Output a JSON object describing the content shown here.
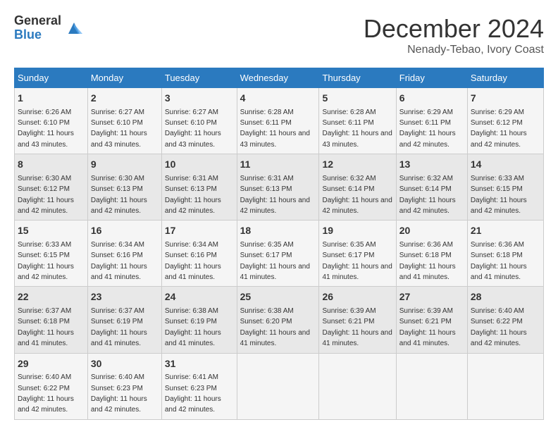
{
  "logo": {
    "general": "General",
    "blue": "Blue"
  },
  "title": {
    "month": "December 2024",
    "location": "Nenady-Tebao, Ivory Coast"
  },
  "days_of_week": [
    "Sunday",
    "Monday",
    "Tuesday",
    "Wednesday",
    "Thursday",
    "Friday",
    "Saturday"
  ],
  "weeks": [
    [
      {
        "day": "1",
        "info": "Sunrise: 6:26 AM\nSunset: 6:10 PM\nDaylight: 11 hours and 43 minutes."
      },
      {
        "day": "2",
        "info": "Sunrise: 6:27 AM\nSunset: 6:10 PM\nDaylight: 11 hours and 43 minutes."
      },
      {
        "day": "3",
        "info": "Sunrise: 6:27 AM\nSunset: 6:10 PM\nDaylight: 11 hours and 43 minutes."
      },
      {
        "day": "4",
        "info": "Sunrise: 6:28 AM\nSunset: 6:11 PM\nDaylight: 11 hours and 43 minutes."
      },
      {
        "day": "5",
        "info": "Sunrise: 6:28 AM\nSunset: 6:11 PM\nDaylight: 11 hours and 43 minutes."
      },
      {
        "day": "6",
        "info": "Sunrise: 6:29 AM\nSunset: 6:11 PM\nDaylight: 11 hours and 42 minutes."
      },
      {
        "day": "7",
        "info": "Sunrise: 6:29 AM\nSunset: 6:12 PM\nDaylight: 11 hours and 42 minutes."
      }
    ],
    [
      {
        "day": "8",
        "info": "Sunrise: 6:30 AM\nSunset: 6:12 PM\nDaylight: 11 hours and 42 minutes."
      },
      {
        "day": "9",
        "info": "Sunrise: 6:30 AM\nSunset: 6:13 PM\nDaylight: 11 hours and 42 minutes."
      },
      {
        "day": "10",
        "info": "Sunrise: 6:31 AM\nSunset: 6:13 PM\nDaylight: 11 hours and 42 minutes."
      },
      {
        "day": "11",
        "info": "Sunrise: 6:31 AM\nSunset: 6:13 PM\nDaylight: 11 hours and 42 minutes."
      },
      {
        "day": "12",
        "info": "Sunrise: 6:32 AM\nSunset: 6:14 PM\nDaylight: 11 hours and 42 minutes."
      },
      {
        "day": "13",
        "info": "Sunrise: 6:32 AM\nSunset: 6:14 PM\nDaylight: 11 hours and 42 minutes."
      },
      {
        "day": "14",
        "info": "Sunrise: 6:33 AM\nSunset: 6:15 PM\nDaylight: 11 hours and 42 minutes."
      }
    ],
    [
      {
        "day": "15",
        "info": "Sunrise: 6:33 AM\nSunset: 6:15 PM\nDaylight: 11 hours and 42 minutes."
      },
      {
        "day": "16",
        "info": "Sunrise: 6:34 AM\nSunset: 6:16 PM\nDaylight: 11 hours and 41 minutes."
      },
      {
        "day": "17",
        "info": "Sunrise: 6:34 AM\nSunset: 6:16 PM\nDaylight: 11 hours and 41 minutes."
      },
      {
        "day": "18",
        "info": "Sunrise: 6:35 AM\nSunset: 6:17 PM\nDaylight: 11 hours and 41 minutes."
      },
      {
        "day": "19",
        "info": "Sunrise: 6:35 AM\nSunset: 6:17 PM\nDaylight: 11 hours and 41 minutes."
      },
      {
        "day": "20",
        "info": "Sunrise: 6:36 AM\nSunset: 6:18 PM\nDaylight: 11 hours and 41 minutes."
      },
      {
        "day": "21",
        "info": "Sunrise: 6:36 AM\nSunset: 6:18 PM\nDaylight: 11 hours and 41 minutes."
      }
    ],
    [
      {
        "day": "22",
        "info": "Sunrise: 6:37 AM\nSunset: 6:18 PM\nDaylight: 11 hours and 41 minutes."
      },
      {
        "day": "23",
        "info": "Sunrise: 6:37 AM\nSunset: 6:19 PM\nDaylight: 11 hours and 41 minutes."
      },
      {
        "day": "24",
        "info": "Sunrise: 6:38 AM\nSunset: 6:19 PM\nDaylight: 11 hours and 41 minutes."
      },
      {
        "day": "25",
        "info": "Sunrise: 6:38 AM\nSunset: 6:20 PM\nDaylight: 11 hours and 41 minutes."
      },
      {
        "day": "26",
        "info": "Sunrise: 6:39 AM\nSunset: 6:21 PM\nDaylight: 11 hours and 41 minutes."
      },
      {
        "day": "27",
        "info": "Sunrise: 6:39 AM\nSunset: 6:21 PM\nDaylight: 11 hours and 41 minutes."
      },
      {
        "day": "28",
        "info": "Sunrise: 6:40 AM\nSunset: 6:22 PM\nDaylight: 11 hours and 42 minutes."
      }
    ],
    [
      {
        "day": "29",
        "info": "Sunrise: 6:40 AM\nSunset: 6:22 PM\nDaylight: 11 hours and 42 minutes."
      },
      {
        "day": "30",
        "info": "Sunrise: 6:40 AM\nSunset: 6:23 PM\nDaylight: 11 hours and 42 minutes."
      },
      {
        "day": "31",
        "info": "Sunrise: 6:41 AM\nSunset: 6:23 PM\nDaylight: 11 hours and 42 minutes."
      },
      {
        "day": "",
        "info": ""
      },
      {
        "day": "",
        "info": ""
      },
      {
        "day": "",
        "info": ""
      },
      {
        "day": "",
        "info": ""
      }
    ]
  ]
}
